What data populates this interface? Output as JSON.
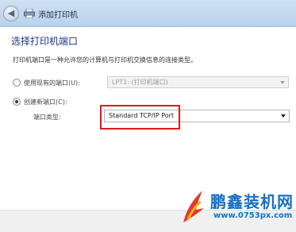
{
  "window": {
    "title": "添加打印机",
    "back_icon": "back-arrow-icon",
    "printer_icon": "printer-icon"
  },
  "main": {
    "heading": "选择打印机端口",
    "description": "打印机端口是一种允许您的计算机与打印机交换信息的连接类型。",
    "existing_port": {
      "label": "使用现有的端口(U):",
      "selected": false,
      "value": "LPT1: (打印机端口)",
      "enabled": false
    },
    "new_port": {
      "label": "创建新端口(C):",
      "selected": true,
      "type_label": "端口类型:",
      "value": "Standard TCP/IP Port",
      "enabled": true
    }
  },
  "watermark": {
    "brand": "鹏鑫装机网",
    "url": "www.0753px.com"
  },
  "colors": {
    "heading": "#1e3287",
    "highlight": "#e0191b",
    "watermark": "#1670c4"
  }
}
